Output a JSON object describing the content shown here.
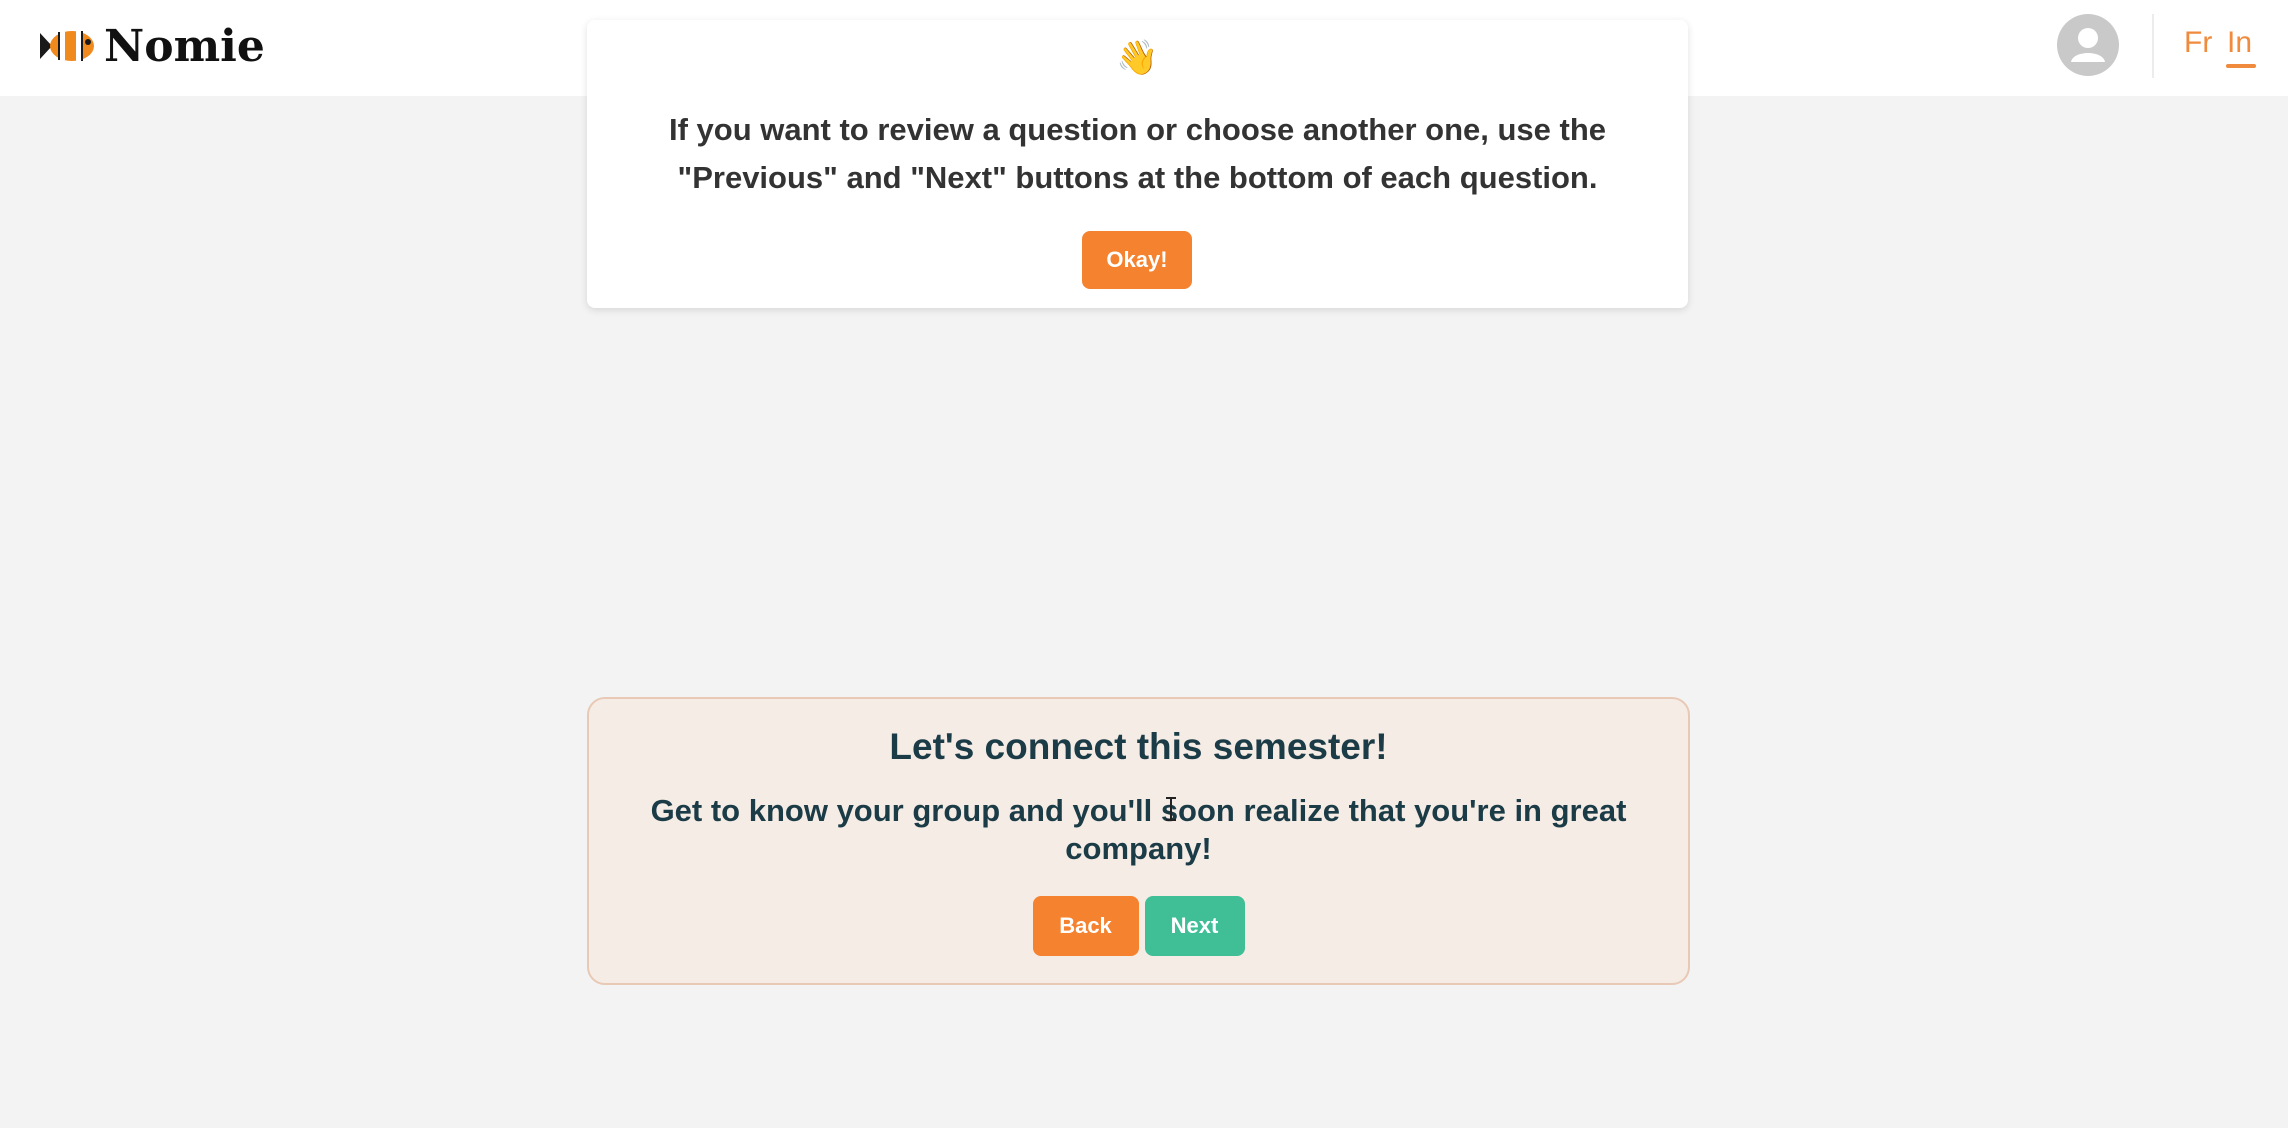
{
  "header": {
    "logo_text": "Nomie",
    "languages": [
      {
        "code": "Fr",
        "active": false
      },
      {
        "code": "In",
        "active": true
      }
    ],
    "accent_color": "#f08a3c"
  },
  "tooltip": {
    "emoji": "👋",
    "message": "If you want to review a question or choose another one, use the \"Previous\" and \"Next\" buttons at the bottom of each question.",
    "button_label": "Okay!"
  },
  "card": {
    "title": "Let's connect this semester!",
    "subtitle": "Get to know your group and you'll soon realize that you're in great company!",
    "back_label": "Back",
    "next_label": "Next"
  },
  "colors": {
    "primary_orange": "#f5822f",
    "primary_green": "#40bf97",
    "card_background": "#f6ece6",
    "text_dark": "#1b3c47"
  }
}
